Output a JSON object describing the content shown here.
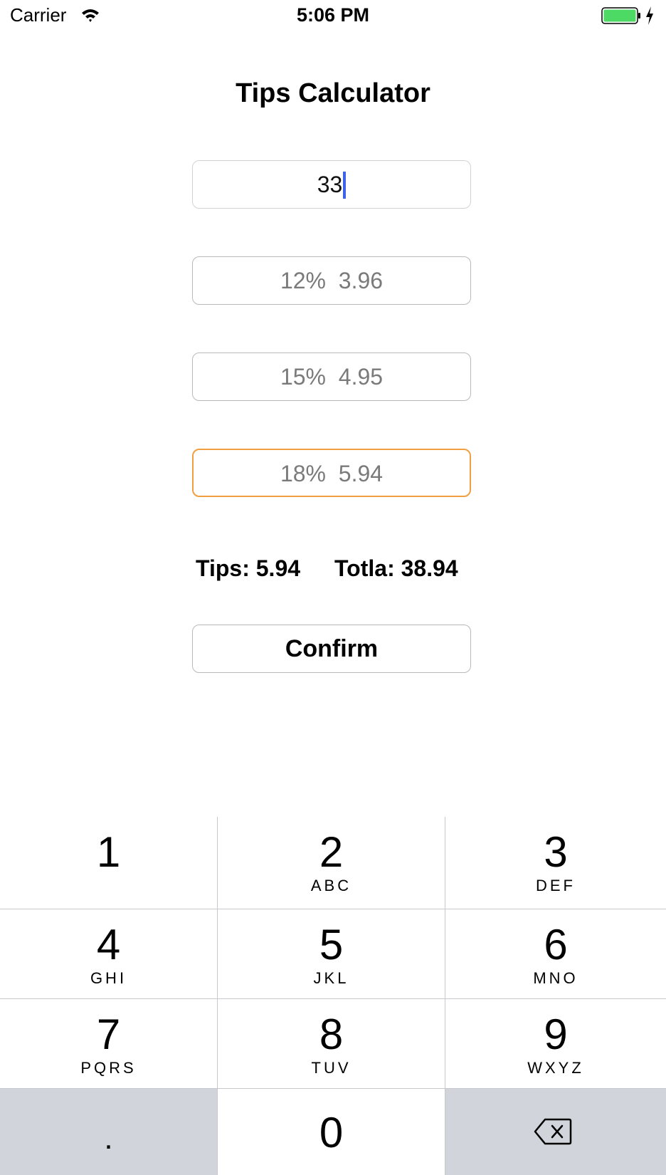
{
  "status_bar": {
    "carrier": "Carrier",
    "time": "5:06 PM",
    "battery_color": "#4cd964",
    "icons": [
      "wifi-icon",
      "battery-icon",
      "charging-bolt-icon"
    ]
  },
  "title": "Tips Calculator",
  "amount_field": {
    "value": "33",
    "cursor_color": "#3f63e6"
  },
  "tip_options": [
    {
      "percent": "12%",
      "amount": "3.96"
    },
    {
      "percent": "15%",
      "amount": "4.95"
    },
    {
      "percent": "18%",
      "amount": "5.94",
      "selected": true
    }
  ],
  "tip_option_labels": [
    "12%  3.96",
    "15%  4.95",
    "18%  5.94"
  ],
  "selected_border_color": "#f0a040",
  "summary": {
    "tips": "Tips: 5.94",
    "total": "Totla: 38.94"
  },
  "confirm_label": "Confirm",
  "keypad": {
    "keys": [
      {
        "digit": "1",
        "letters": ""
      },
      {
        "digit": "2",
        "letters": "ABC"
      },
      {
        "digit": "3",
        "letters": "DEF"
      },
      {
        "digit": "4",
        "letters": "GHI"
      },
      {
        "digit": "5",
        "letters": "JKL"
      },
      {
        "digit": "6",
        "letters": "MNO"
      },
      {
        "digit": "7",
        "letters": "PQRS"
      },
      {
        "digit": "8",
        "letters": "TUV"
      },
      {
        "digit": "9",
        "letters": "WXYZ"
      },
      {
        "digit": ".",
        "letters": ""
      },
      {
        "digit": "0",
        "letters": ""
      }
    ],
    "backspace_icon": "backspace-icon",
    "function_key_color": "#d1d4da"
  }
}
